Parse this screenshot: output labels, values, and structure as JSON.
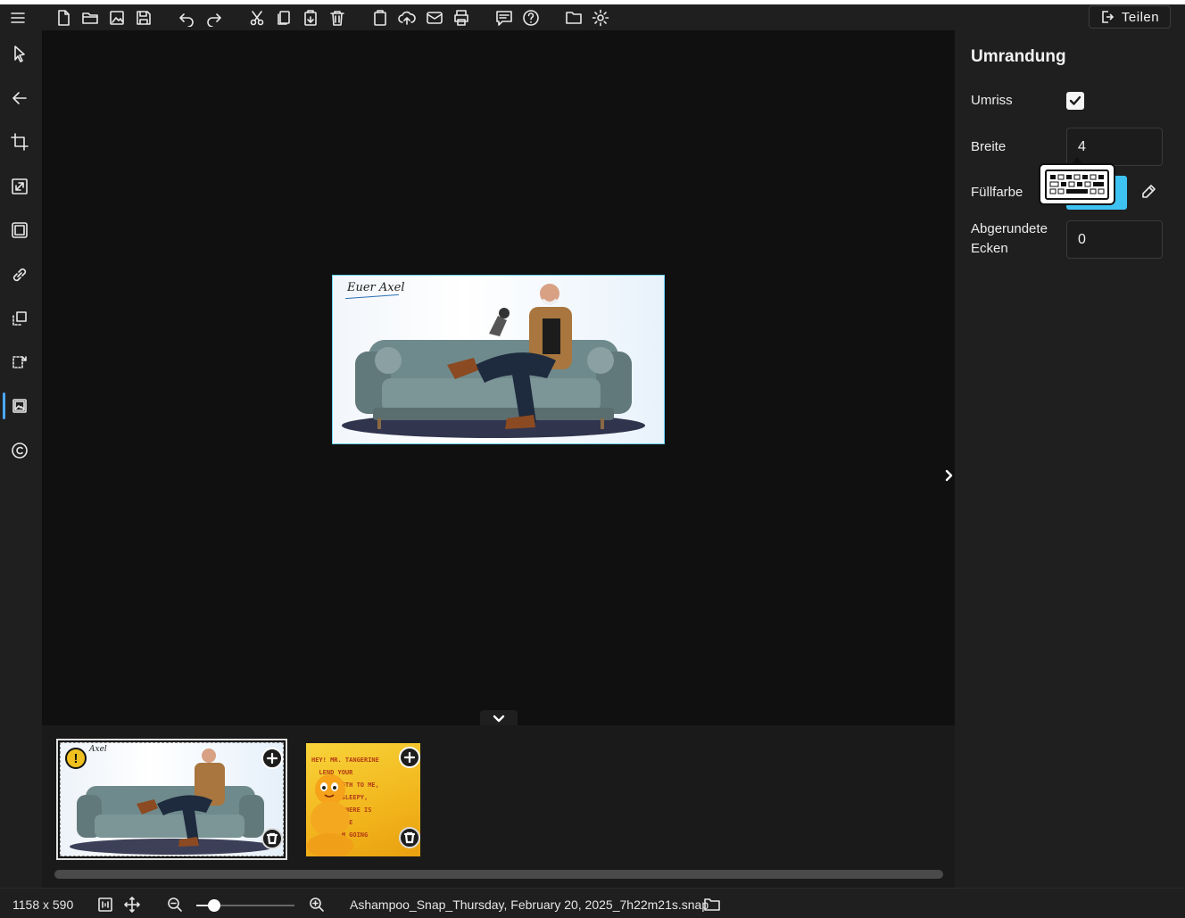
{
  "toolbar": {
    "icons": [
      "menu-icon",
      "new-file-icon",
      "open-folder-icon",
      "edit-image-icon",
      "save-icon",
      "undo-icon",
      "redo-icon",
      "cut-icon",
      "copy-icon",
      "paste-icon",
      "delete-icon",
      "clipboard-icon",
      "upload-cloud-icon",
      "email-icon",
      "print-icon",
      "feedback-icon",
      "help-icon",
      "folder-icon",
      "settings-icon"
    ],
    "share_label": "Teilen"
  },
  "sidebar": {
    "icons": [
      "pointer-icon",
      "arrow-left-icon",
      "crop-icon",
      "resize-icon",
      "border-frame-icon",
      "link-icon",
      "select-region-icon",
      "transform-icon",
      "image-icon",
      "copyright-icon"
    ],
    "active": "image-icon"
  },
  "canvas": {
    "caption": "Euer Axel"
  },
  "panel": {
    "title": "Umrandung",
    "outline_label": "Umriss",
    "outline_checked": true,
    "width_label": "Breite",
    "width_value": "4",
    "fill_label": "Füllfarbe",
    "fill_color": "#3ec2f2",
    "corners_label_1": "Abgerundete",
    "corners_label_2": "Ecken",
    "corners_value": "0"
  },
  "filmstrip": {
    "thumb1_caption": "Axel",
    "thumb2_text": "HEY! MR. TANGERINE\n  LEND YOUR\n   STRENGTH TO ME,\n   I AM SLEEPY,\n    AND THERE IS\n    A PLACE\n      I'M GOING"
  },
  "status": {
    "dimensions": "1158 x 590",
    "zoom_fraction": 0.18,
    "filename": "Ashampoo_Snap_Thursday, February 20, 2025_7h22m21s.snap"
  }
}
